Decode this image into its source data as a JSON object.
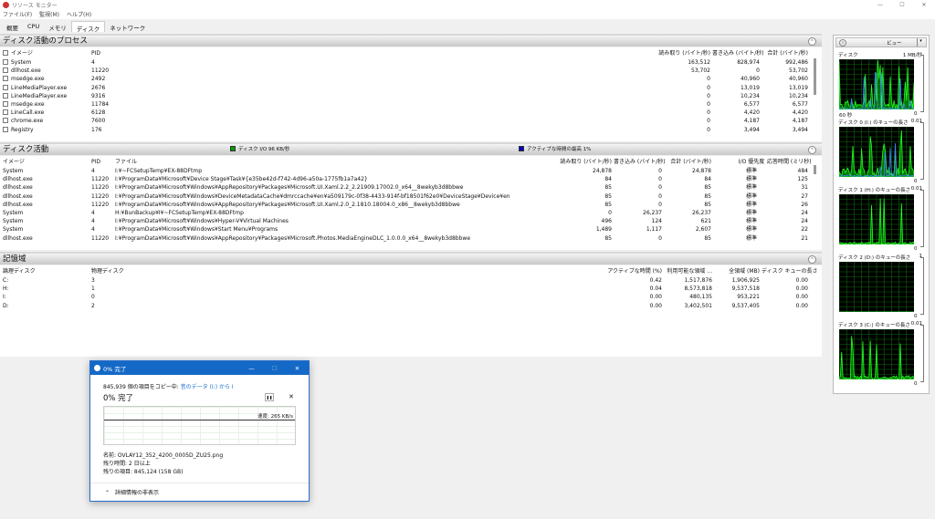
{
  "window": {
    "title": "リソース モニター",
    "minimize": "—",
    "maximize": "☐",
    "close": "✕"
  },
  "menu": [
    "ファイル(F)",
    "監視(M)",
    "ヘルプ(H)"
  ],
  "tabs": [
    "概要",
    "CPU",
    "メモリ",
    "ディスク",
    "ネットワーク"
  ],
  "processes": {
    "title": "ディスク活動のプロセス",
    "headers": [
      "イメージ",
      "PID",
      "読み取り (バイト/秒)",
      "書き込み (バイト/秒)",
      "合計 (バイト/秒)"
    ],
    "rows": [
      [
        "System",
        "4",
        "163,512",
        "828,974",
        "992,486"
      ],
      [
        "dllhost.exe",
        "11220",
        "53,702",
        "0",
        "53,702"
      ],
      [
        "msedge.exe",
        "2492",
        "0",
        "40,960",
        "40,960"
      ],
      [
        "LineMediaPlayer.exe",
        "2676",
        "0",
        "13,019",
        "13,019"
      ],
      [
        "LineMediaPlayer.exe",
        "9316",
        "0",
        "10,234",
        "10,234"
      ],
      [
        "msedge.exe",
        "11784",
        "0",
        "6,577",
        "6,577"
      ],
      [
        "LineCall.exe",
        "6128",
        "0",
        "4,420",
        "4,420"
      ],
      [
        "chrome.exe",
        "7600",
        "0",
        "4,187",
        "4,187"
      ],
      [
        "Registry",
        "176",
        "0",
        "3,494",
        "3,494"
      ]
    ]
  },
  "activity": {
    "title": "ディスク活動",
    "legend_io": "ディスク I/O 96 KB/秒",
    "legend_active": "アクティブな時間の最高 1%",
    "io_color": "#00a000",
    "active_color": "#0000c0",
    "headers": [
      "イメージ",
      "PID",
      "ファイル",
      "読み取り (バイト/秒)",
      "書き込み (バイト/秒)",
      "合計 (バイト/秒)",
      "I/O 優先度",
      "応答時間 (ミリ秒)"
    ],
    "rows": [
      [
        "System",
        "4",
        "I:¥~FCSetupTemp¥EX-88DFtmp",
        "24,878",
        "0",
        "24,878",
        "標準",
        "484"
      ],
      [
        "dllhost.exe",
        "11220",
        "I:¥ProgramData¥Microsoft¥Device Stage¥Task¥{e35be42d-f742-4d96-a50a-1775fb1a7a42}",
        "84",
        "0",
        "84",
        "標準",
        "125"
      ],
      [
        "dllhost.exe",
        "11220",
        "I:¥ProgramData¥Microsoft¥Windows¥AppRepository¥Packages¥Microsoft.UI.Xaml.2.2_2.21909.17002.0_x64__8wekyb3d8bbwe",
        "85",
        "0",
        "85",
        "標準",
        "31"
      ],
      [
        "dllhost.exe",
        "11220",
        "I:¥ProgramData¥Microsoft¥Windows¥DeviceMetadataCache¥dmrccache¥en¥a509179c-0f38-4433-914f-bf18501f62e0¥DeviceStage¥Device¥en",
        "85",
        "0",
        "85",
        "標準",
        "27"
      ],
      [
        "dllhost.exe",
        "11220",
        "I:¥ProgramData¥Microsoft¥Windows¥AppRepository¥Packages¥Microsoft.UI.Xaml.2.0_2.1810.18004.0_x86__8wekyb3d8bbwe",
        "85",
        "0",
        "85",
        "標準",
        "26"
      ],
      [
        "System",
        "4",
        "H:¥BunBackup¥I¥~FCSetupTemp¥EX-88DFtmp",
        "0",
        "26,237",
        "26,237",
        "標準",
        "24"
      ],
      [
        "System",
        "4",
        "I:¥ProgramData¥Microsoft¥Windows¥Hyper-V¥Virtual Machines",
        "496",
        "124",
        "621",
        "標準",
        "24"
      ],
      [
        "System",
        "4",
        "I:¥ProgramData¥Microsoft¥Windows¥Start Menu¥Programs",
        "1,489",
        "1,117",
        "2,607",
        "標準",
        "22"
      ],
      [
        "dllhost.exe",
        "11220",
        "I:¥ProgramData¥Microsoft¥Windows¥AppRepository¥Packages¥Microsoft.Photos.MediaEngineDLC_1.0.0.0_x64__8wekyb3d8bbwe",
        "85",
        "0",
        "85",
        "標準",
        "21"
      ]
    ]
  },
  "storage": {
    "title": "記憶域",
    "headers": [
      "論理ディスク",
      "物理ディスク",
      "アクティブな時間 (%)",
      "利用可能な領域 ...",
      "全領域 (MB)",
      "ディスク キューの長さ"
    ],
    "rows": [
      [
        "C:",
        "3",
        "0.42",
        "1,517,876",
        "1,906,925",
        "0.00"
      ],
      [
        "H:",
        "1",
        "0.04",
        "8,573,818",
        "9,537,518",
        "0.00"
      ],
      [
        "I:",
        "0",
        "0.00",
        "480,135",
        "953,221",
        "0.00"
      ],
      [
        "D:",
        "2",
        "0.00",
        "3,402,501",
        "9,537,405",
        "0.00"
      ]
    ]
  },
  "side": {
    "view_label": "ビュー",
    "graphs": [
      {
        "title": "ディスク",
        "max": "1 MB/秒",
        "footer_left": "60 秒",
        "footer_right": "0",
        "activity": 0.75
      },
      {
        "title": "ディスク 0 (I:) のキューの長さ",
        "max": "0.01",
        "footer_right": "0",
        "activity": 0.8
      },
      {
        "title": "ディスク 1 (H:) のキューの長さ",
        "max": "0.01",
        "footer_right": "0",
        "activity": 0.2
      },
      {
        "title": "ディスク 2 (D:) のキューの長さ",
        "max": "1",
        "footer_right": "0",
        "activity": 0
      },
      {
        "title": "ディスク 3 (C:) のキューの長さ",
        "max": "0.01",
        "footer_right": "0",
        "activity": 0.3
      }
    ]
  },
  "dialog": {
    "title": "0% 完了",
    "copy_prefix": "845,939 個の項目をコピー中: ",
    "source": "昔のデータ (I:)",
    "copy_suffix": " から I",
    "progress_text": "0% 完了",
    "progress_percent": 0,
    "speed": "速度: 265 KB/s",
    "name": "名前: OVLAY12_352_4200_0005D_ZU25.png",
    "time_left": "残り時間: 2 日以上",
    "items_left": "残りの項目: 845,124 (158 GB)",
    "details_toggle": "詳細情報の非表示",
    "pause": "❚❚",
    "cancel": "✕"
  }
}
